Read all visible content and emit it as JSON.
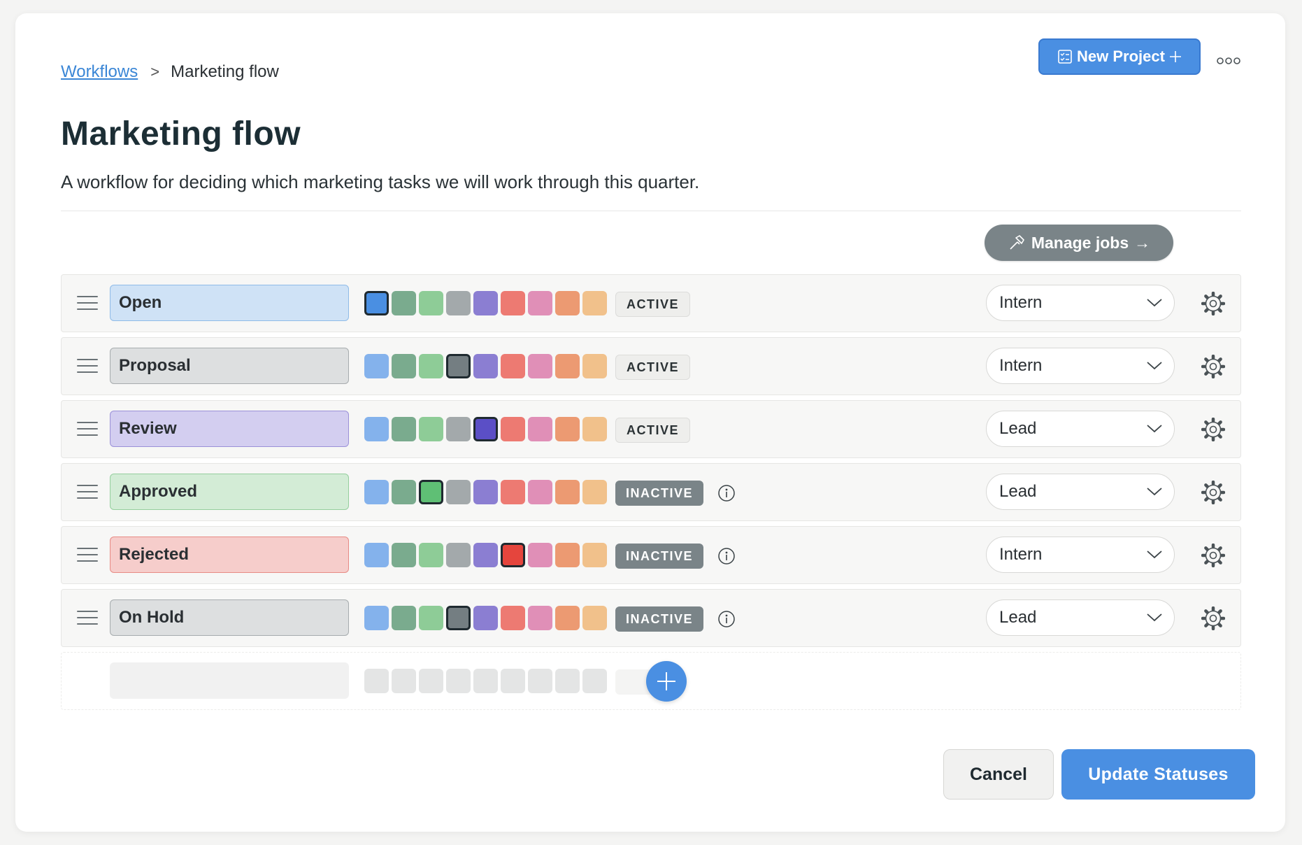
{
  "breadcrumb": {
    "parent": "Workflows",
    "separator": ">",
    "current": "Marketing flow"
  },
  "header": {
    "new_project_label": "New Project",
    "more_icon": "ellipsis-icon"
  },
  "page": {
    "title": "Marketing flow",
    "description": "A workflow for deciding which marketing tasks we will work through this quarter."
  },
  "manage_jobs": {
    "label": "Manage jobs",
    "icon": "hammer-icon",
    "arrow": "→"
  },
  "palette": [
    "#84b2ec",
    "#7aab8e",
    "#8ecc97",
    "#a3a9ab",
    "#8b7ed2",
    "#ed7a72",
    "#e08fb7",
    "#ec9a72",
    "#f1c18b"
  ],
  "selected_colors": [
    "#4a8fe2",
    "#7aab8e",
    "#5fbf75",
    "#747e82",
    "#5b4fc6",
    "#e5453d",
    "#e08fb7",
    "#ec9a72",
    "#f1c18b"
  ],
  "statuses": [
    {
      "name": "Open",
      "bg": "#cfe2f6",
      "border": "#8fbbe8",
      "color_index": 0,
      "state": "ACTIVE",
      "state_type": "active",
      "role": "Intern"
    },
    {
      "name": "Proposal",
      "bg": "#dddfe0",
      "border": "#a7acae",
      "color_index": 3,
      "state": "ACTIVE",
      "state_type": "active",
      "role": "Intern"
    },
    {
      "name": "Review",
      "bg": "#d3cef0",
      "border": "#9b91d8",
      "color_index": 4,
      "state": "ACTIVE",
      "state_type": "active",
      "role": "Lead"
    },
    {
      "name": "Approved",
      "bg": "#d3ecd6",
      "border": "#95cf9e",
      "color_index": 2,
      "state": "INACTIVE",
      "state_type": "inactive",
      "role": "Lead"
    },
    {
      "name": "Rejected",
      "bg": "#f6cdcb",
      "border": "#e88b85",
      "color_index": 5,
      "state": "INACTIVE",
      "state_type": "inactive",
      "role": "Intern"
    },
    {
      "name": "On Hold",
      "bg": "#dddfe0",
      "border": "#a7acae",
      "color_index": 3,
      "state": "INACTIVE",
      "state_type": "inactive",
      "role": "Lead"
    }
  ],
  "footer": {
    "cancel_label": "Cancel",
    "update_label": "Update Statuses"
  }
}
